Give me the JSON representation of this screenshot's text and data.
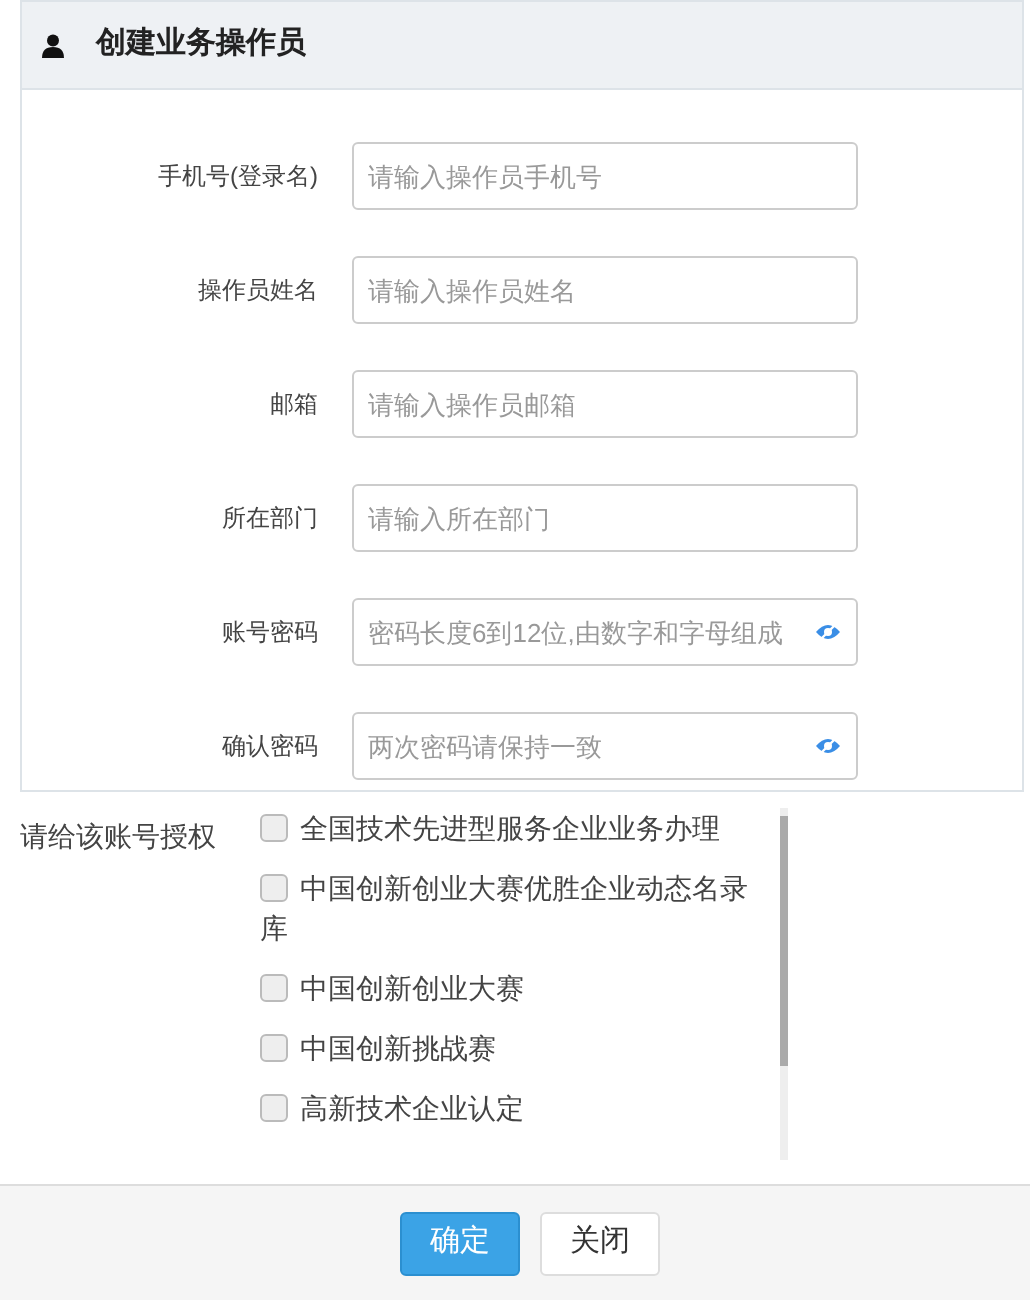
{
  "panel": {
    "title": "创建业务操作员"
  },
  "fields": [
    {
      "label": "手机号(登录名)",
      "placeholder": "请输入操作员手机号",
      "kind": "text"
    },
    {
      "label": "操作员姓名",
      "placeholder": "请输入操作员姓名",
      "kind": "text"
    },
    {
      "label": "邮箱",
      "placeholder": "请输入操作员邮箱",
      "kind": "text"
    },
    {
      "label": "所在部门",
      "placeholder": "请输入所在部门",
      "kind": "text"
    },
    {
      "label": "账号密码",
      "placeholder": "密码长度6到12位,由数字和字母组成",
      "kind": "password"
    },
    {
      "label": "确认密码",
      "placeholder": "两次密码请保持一致",
      "kind": "password"
    }
  ],
  "authorization": {
    "label": "请给该账号授权",
    "items": [
      {
        "label": "全国技术先进型服务企业业务办理",
        "checked": false
      },
      {
        "label": "中国创新创业大赛优胜企业动态名录库",
        "checked": false
      },
      {
        "label": "中国创新创业大赛",
        "checked": false
      },
      {
        "label": "中国创新挑战赛",
        "checked": false
      },
      {
        "label": "高新技术企业认定",
        "checked": false
      }
    ]
  },
  "buttons": [
    {
      "label": "确定",
      "kind": "primary"
    },
    {
      "label": "关闭",
      "kind": "default"
    }
  ]
}
